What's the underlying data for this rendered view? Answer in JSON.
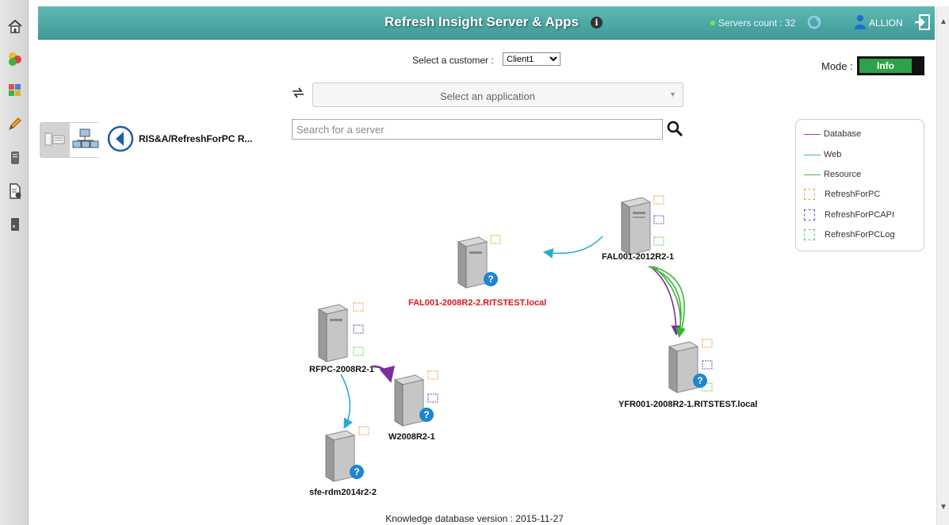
{
  "header": {
    "title": "Refresh Insight Server & Apps",
    "servers_count": "Servers count : 32",
    "user_name": "ALLION"
  },
  "customer": {
    "label": "Select a customer :",
    "selected": "Client1"
  },
  "mode": {
    "label": "Mode :",
    "value": "Info"
  },
  "application": {
    "placeholder": "Select an application"
  },
  "search": {
    "placeholder": "Search for a server"
  },
  "breadcrumb": "RIS&A/RefreshForPC R...",
  "legend": {
    "items": [
      {
        "label": "Database",
        "color": "#9a3fb0",
        "kind": "line"
      },
      {
        "label": "Web",
        "color": "#3fb0d6",
        "kind": "line"
      },
      {
        "label": "Resource",
        "color": "#3fbf3f",
        "kind": "line"
      },
      {
        "label": "RefreshForPC",
        "color": "#f0a040",
        "kind": "box"
      },
      {
        "label": "RefreshForPCAPI",
        "color": "#6a5acd",
        "kind": "box"
      },
      {
        "label": "RefreshForPCLog",
        "color": "#5ccf5c",
        "kind": "box"
      }
    ]
  },
  "servers": [
    {
      "name": "FAL001-2012R2-1",
      "unknown": false,
      "highlight": false
    },
    {
      "name": "FAL001-2008R2-2.RITSTEST.local",
      "unknown": true,
      "highlight": true
    },
    {
      "name": "RFPC-2008R2-1",
      "unknown": false,
      "highlight": false
    },
    {
      "name": "W2008R2-1",
      "unknown": true,
      "highlight": false
    },
    {
      "name": "YFR001-2008R2-1.RITSTEST.local",
      "unknown": true,
      "highlight": false
    },
    {
      "name": "sfe-rdm2014r2-2",
      "unknown": true,
      "highlight": false
    }
  ],
  "footer": "Knowledge database version : 2015-11-27",
  "colors": {
    "header": "#4aa7a3",
    "database": "#7a2f9a",
    "web": "#2aa9d6",
    "resource": "#33b833",
    "mode_on": "#2ea24a",
    "highlight_text": "#e0141e"
  }
}
